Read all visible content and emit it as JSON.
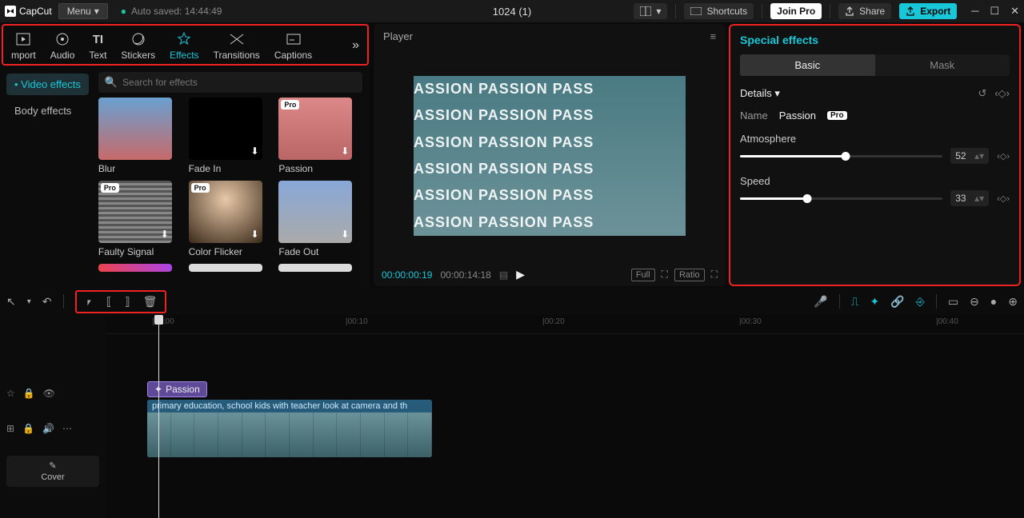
{
  "titlebar": {
    "app": "CapCut",
    "menu": "Menu",
    "autosave": "Auto saved: 14:44:49",
    "project": "1024 (1)",
    "shortcuts": "Shortcuts",
    "joinPro": "Join Pro",
    "share": "Share",
    "export": "Export"
  },
  "topTabs": {
    "import": "mport",
    "audio": "Audio",
    "text": "Text",
    "stickers": "Stickers",
    "effects": "Effects",
    "transitions": "Transitions",
    "captions": "Captions"
  },
  "sideTabs": {
    "video": "Video effects",
    "body": "Body effects"
  },
  "search": {
    "placeholder": "Search for effects"
  },
  "effects": {
    "blur": "Blur",
    "fadeIn": "Fade In",
    "passion": "Passion",
    "faulty": "Faulty Signal",
    "colorFlicker": "Color Flicker",
    "fadeOut": "Fade Out",
    "pro": "Pro"
  },
  "player": {
    "title": "Player",
    "curTime": "00:00:00:19",
    "totalTime": "00:00:14:18",
    "full": "Full",
    "ratio": "Ratio",
    "passionWord": "ASSION PASSION PASS"
  },
  "rightPanel": {
    "title": "Special effects",
    "tabBasic": "Basic",
    "tabMask": "Mask",
    "details": "Details",
    "nameLabel": "Name",
    "nameValue": "Passion",
    "pro": "Pro",
    "atmosphere": {
      "label": "Atmosphere",
      "value": "52",
      "pct": 52
    },
    "speed": {
      "label": "Speed",
      "value": "33",
      "pct": 33
    }
  },
  "timeline": {
    "ticks": [
      "00:00",
      "00:10",
      "00:20",
      "00:30",
      "00:40"
    ],
    "effectClip": "Passion",
    "videoLabel": "primary education, school kids with teacher look at camera and th",
    "cover": "Cover"
  }
}
